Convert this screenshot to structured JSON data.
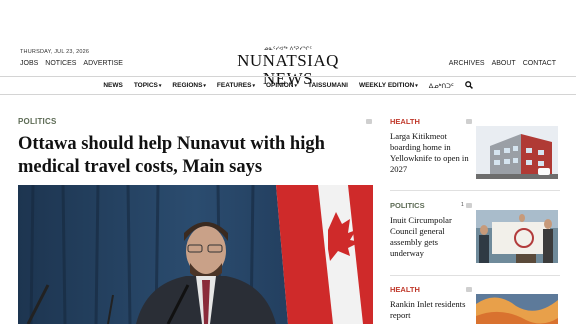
{
  "header": {
    "date": "THURSDAY, JUL 23, 2026",
    "left_links": [
      "JOBS",
      "NOTICES",
      "ADVERTISE"
    ],
    "right_links": [
      "ARCHIVES",
      "ABOUT",
      "CONTACT"
    ],
    "logo_syllabics": "ᓄᓇᑦᓯᐊᖅ ᐱᕐᕈᓯᖏᑦ",
    "logo_text": "NUNATSIAQ NEWS"
  },
  "nav": {
    "items": [
      {
        "label": "NEWS",
        "dropdown": false
      },
      {
        "label": "TOPICS",
        "dropdown": true
      },
      {
        "label": "REGIONS",
        "dropdown": true
      },
      {
        "label": "FEATURES",
        "dropdown": true
      },
      {
        "label": "OPINION",
        "dropdown": true
      },
      {
        "label": "TAISSUMANI",
        "dropdown": false
      },
      {
        "label": "WEEKLY EDITION",
        "dropdown": true
      },
      {
        "label": "ᐃᓄᒃᑎᑐᑦ",
        "dropdown": false
      }
    ],
    "search_icon": "search-icon"
  },
  "main": {
    "kicker": "POLITICS",
    "headline": "Ottawa should help Nunavut with high medical travel costs, Main says"
  },
  "sidebar": {
    "cards": [
      {
        "tag": "HEALTH",
        "tag_color": "#c0392b",
        "title": "Larga Kitikmeot boarding home in Yellowknife to open in 2027",
        "count": ""
      },
      {
        "tag": "POLITICS",
        "tag_color": "#5d6b55",
        "title": "Inuit Circumpolar Council general assembly gets underway",
        "count": "1"
      },
      {
        "tag": "HEALTH",
        "tag_color": "#c0392b",
        "title": "Rankin Inlet residents report",
        "count": ""
      }
    ]
  },
  "colors": {
    "politics": "#5d6b55",
    "health": "#c0392b"
  }
}
